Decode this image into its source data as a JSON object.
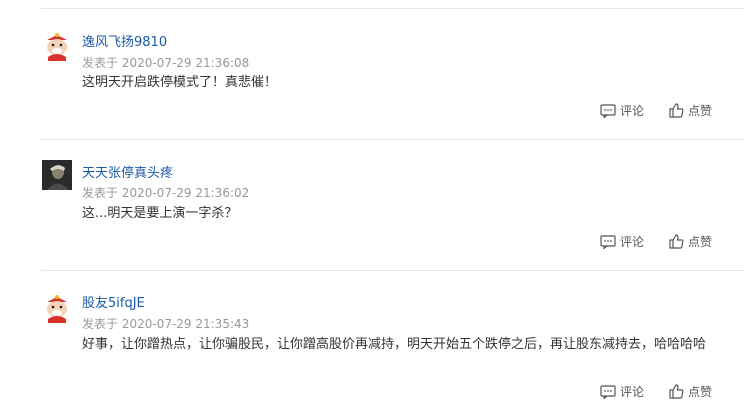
{
  "comments": [
    {
      "username": "逸风飞扬9810",
      "meta": "发表于 2020-07-29 21:36:08",
      "content": "这明天开启跌停模式了！真悲催！",
      "avatar": "cartoon-avatar",
      "comment_label": "评论",
      "like_label": "点赞"
    },
    {
      "username": "天天张停真头疼",
      "meta": "发表于 2020-07-29 21:36:02",
      "content": "这...明天是要上演一字杀？",
      "avatar": "portrait-avatar",
      "comment_label": "评论",
      "like_label": "点赞"
    },
    {
      "username": "股友5ifqJE",
      "meta": "发表于 2020-07-29 21:35:43",
      "content": "好事，让你蹭热点，让你骗股民，让你蹭高股价再减持，明天开始五个跌停之后，再让股东减持去，哈哈哈哈",
      "avatar": "cartoon-avatar",
      "comment_label": "评论",
      "like_label": "点赞"
    }
  ],
  "colors": {
    "username": "#1a5aa6",
    "meta": "#999999",
    "content": "#333333",
    "divider": "#e6e6e6"
  }
}
